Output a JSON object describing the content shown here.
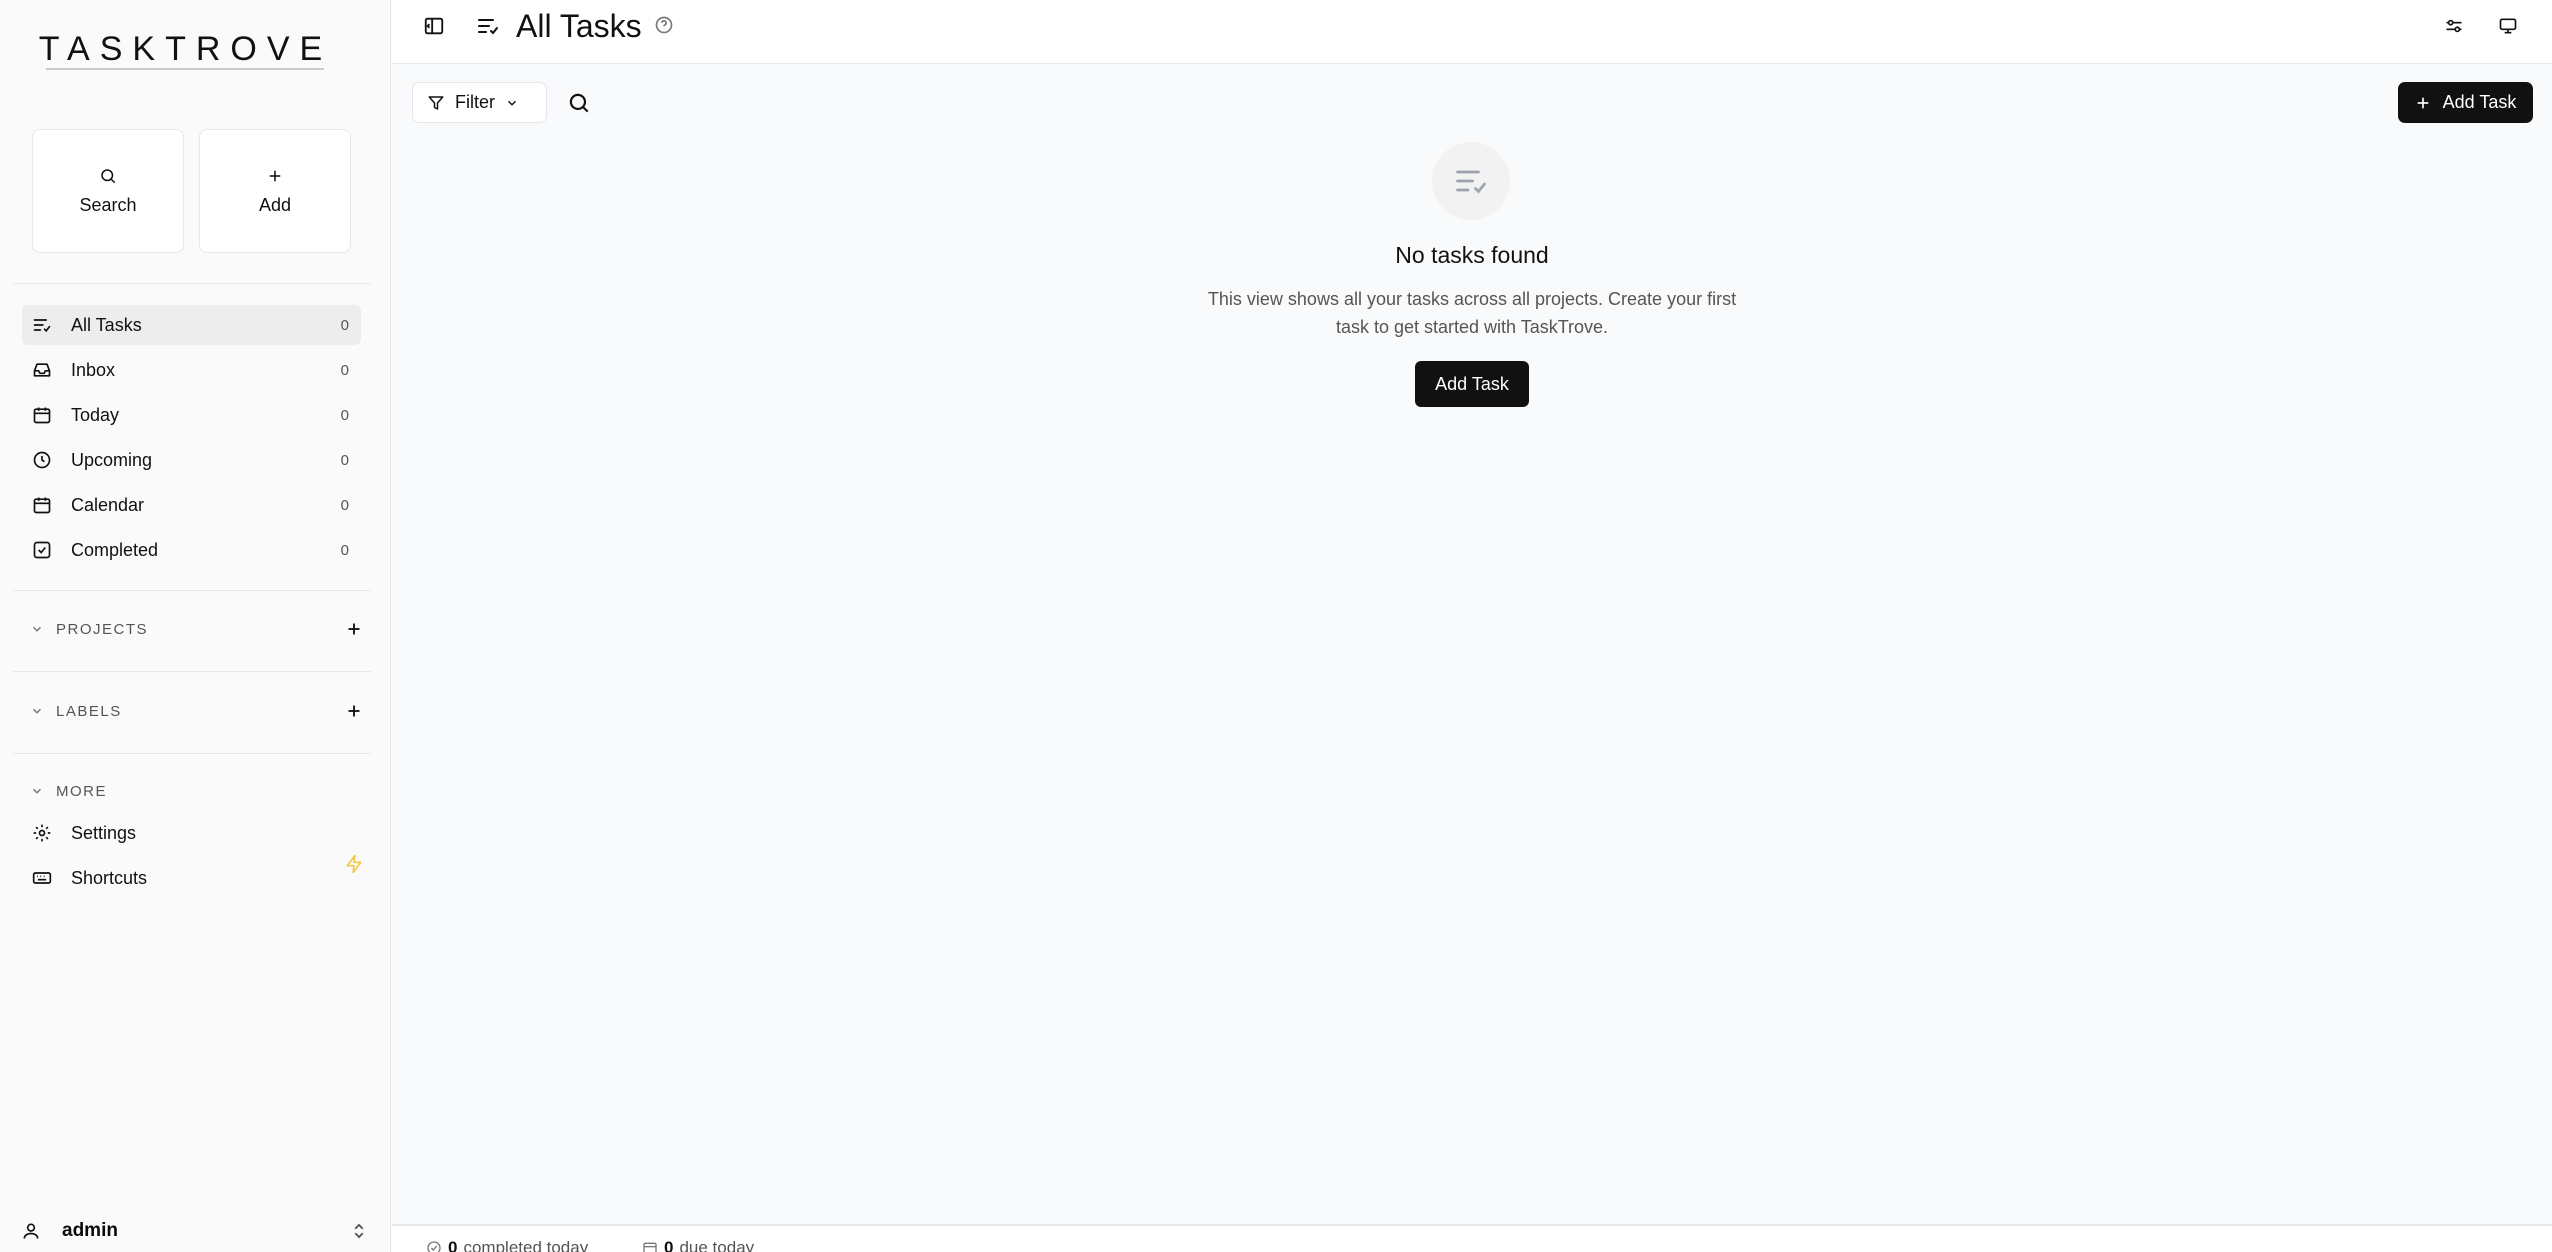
{
  "app": {
    "logo": "TASKTROVE"
  },
  "quick_actions": {
    "search_label": "Search",
    "add_label": "Add"
  },
  "nav": {
    "items": [
      {
        "label": "All Tasks",
        "count": "0",
        "icon": "list-check-icon"
      },
      {
        "label": "Inbox",
        "count": "0",
        "icon": "inbox-icon"
      },
      {
        "label": "Today",
        "count": "0",
        "icon": "calendar-icon"
      },
      {
        "label": "Upcoming",
        "count": "0",
        "icon": "clock-icon"
      },
      {
        "label": "Calendar",
        "count": "0",
        "icon": "calendar-icon"
      },
      {
        "label": "Completed",
        "count": "0",
        "icon": "check-square-icon"
      }
    ]
  },
  "sections": {
    "projects": "PROJECTS",
    "labels": "LABELS",
    "more": "MORE"
  },
  "more_items": [
    {
      "label": "Settings",
      "icon": "gear-icon"
    },
    {
      "label": "Shortcuts",
      "icon": "keyboard-icon"
    }
  ],
  "user": {
    "name": "admin"
  },
  "header": {
    "title": "All Tasks"
  },
  "toolbar": {
    "filter_label": "Filter",
    "add_task_label": "Add Task"
  },
  "empty_state": {
    "title": "No tasks found",
    "desc_line1": "This view shows all your tasks across all projects. Create your first",
    "desc_line2": "task to get started with TaskTrove.",
    "button_label": "Add Task"
  },
  "status": {
    "completed_count": "0",
    "completed_label": "completed today",
    "due_count": "0",
    "due_label": "due today"
  },
  "colors": {
    "accent": "#111111",
    "bolt": "#f5c542",
    "active_bg": "#ededed"
  }
}
